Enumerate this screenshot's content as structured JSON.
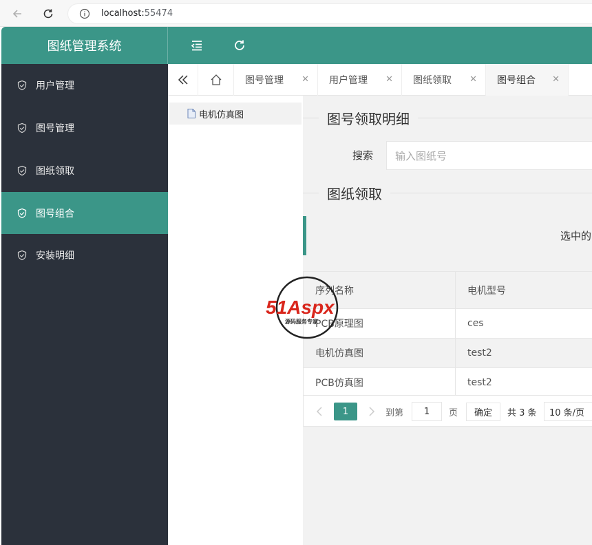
{
  "browser": {
    "url_host": "localhost:",
    "url_port": "55474"
  },
  "app": {
    "title": "图纸管理系统"
  },
  "sidebar": {
    "items": [
      {
        "label": "用户管理"
      },
      {
        "label": "图号管理"
      },
      {
        "label": "图纸领取"
      },
      {
        "label": "图号组合",
        "active": true
      },
      {
        "label": "安装明细"
      }
    ]
  },
  "tabs": [
    {
      "label": "图号管理"
    },
    {
      "label": "用户管理"
    },
    {
      "label": "图纸领取"
    },
    {
      "label": "图号组合",
      "active": true
    }
  ],
  "tree": {
    "items": [
      {
        "label": "电机仿真图"
      }
    ]
  },
  "main": {
    "section1_title": "图号领取明细",
    "search_label": "搜索",
    "search_placeholder": "输入图纸号",
    "section2_title": "图纸领取",
    "notice_text": "选中的"
  },
  "table": {
    "headers": [
      "序列名称",
      "电机型号"
    ],
    "rows": [
      [
        "PCB原理图",
        "ces"
      ],
      [
        "电机仿真图",
        "test2"
      ],
      [
        "PCB仿真图",
        "test2"
      ]
    ]
  },
  "pager": {
    "current_page": "1",
    "goto_label": "到第",
    "goto_value": "1",
    "page_unit": "页",
    "confirm_label": "确定",
    "total_text": "共 3 条",
    "page_size": "10 条/页"
  },
  "watermark": {
    "brand": "51Aspx",
    "tagline": "源码服务专家"
  },
  "colors": {
    "accent": "#3b9688",
    "sidebar_bg": "#2b313b"
  }
}
